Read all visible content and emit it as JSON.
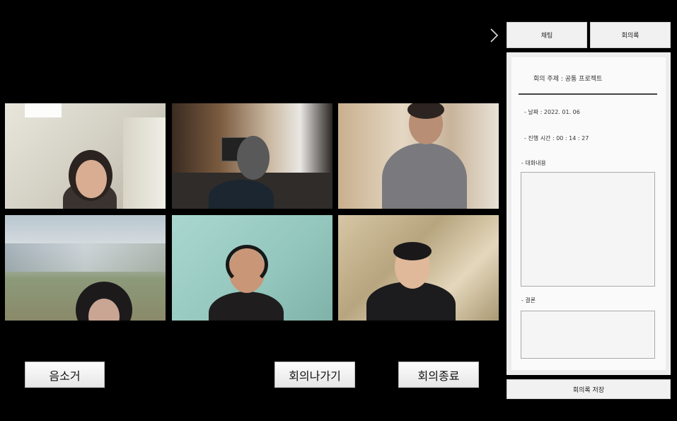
{
  "tiles": [
    {
      "id": "participant-1"
    },
    {
      "id": "participant-2"
    },
    {
      "id": "participant-3"
    },
    {
      "id": "participant-4"
    },
    {
      "id": "participant-5"
    },
    {
      "id": "participant-6"
    }
  ],
  "controls": {
    "mute_label": "음소거",
    "leave_label": "회의나가기",
    "end_label": "회의종료"
  },
  "side": {
    "collapse_icon": "chevron-right",
    "tab_chat": "채팅",
    "tab_minutes": "회의록",
    "topic_label": "회의 주제 :",
    "topic_value": "공통 프로젝트",
    "date_text": "- 날짜 : 2022. 01. 06",
    "elapsed_text": "- 진행 시간 : 00 : 14 : 27",
    "conversation_label": "- 대화내용",
    "conclusion_label": "- 결론",
    "save_label": "회의록 저장"
  }
}
